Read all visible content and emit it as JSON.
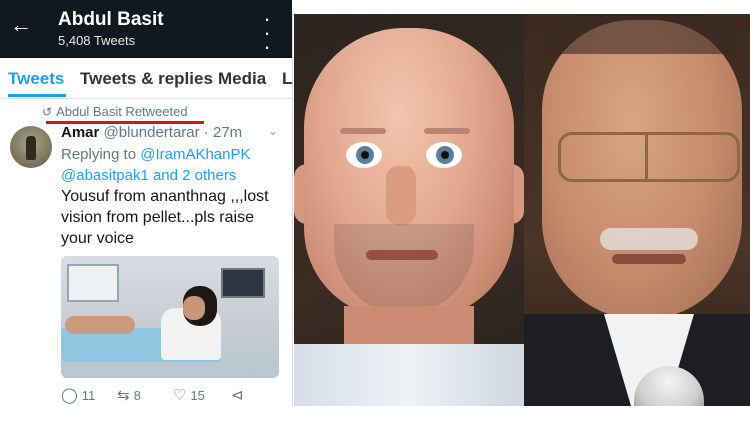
{
  "profile": {
    "name": "Abdul Basit",
    "tweet_count": "5,408 Tweets"
  },
  "tabs": [
    {
      "label": "Tweets"
    },
    {
      "label": "Tweets & replies"
    },
    {
      "label": "Media"
    },
    {
      "label": "L"
    }
  ],
  "tweet": {
    "retweet_label": "Abdul Basit Retweeted",
    "author_name": "Amar",
    "author_handle": "@blundertarar",
    "time": "27m",
    "replying_prefix": "Replying to",
    "mention_1": "@IramAKhanPK",
    "mention_2": "@abasitpak1",
    "mention_suffix": "and 2 others",
    "text": "Yousuf from ananthnag ,,,lost vision from pellet...pls raise your voice",
    "reply_count": "11",
    "retweet_count": "8",
    "like_count": "15"
  },
  "icons": {
    "back": "arrow-left-icon",
    "menu": "vertical-dots-icon",
    "retweet": "retweet-icon",
    "reply": "reply-icon",
    "like": "heart-icon",
    "share": "share-icon"
  },
  "colors": {
    "header_bg": "#101820",
    "accent": "#1da1f2",
    "annotation_red": "#cc1a1a"
  }
}
